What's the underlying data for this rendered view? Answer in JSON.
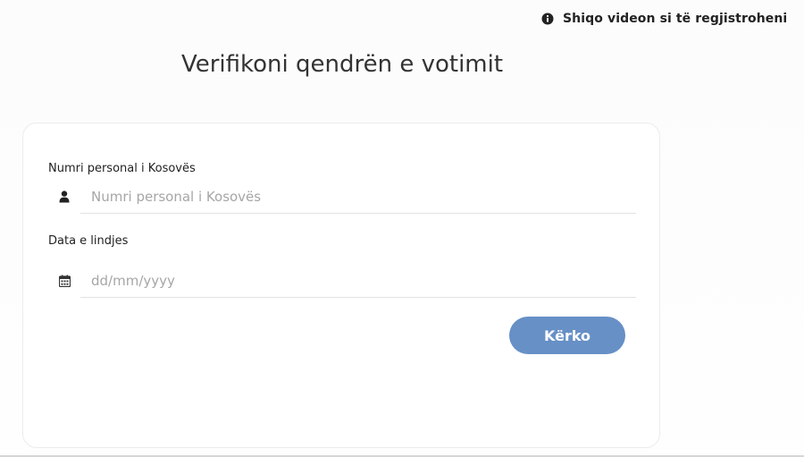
{
  "header": {
    "help_link_label": "Shiqo videon si të regjistroheni",
    "help_icon": "info-icon"
  },
  "title": "Verifikoni qendrën e votimit",
  "form": {
    "personal_number": {
      "label": "Numri personal i Kosovës",
      "placeholder": "Numri personal i Kosovës",
      "value": "",
      "icon": "user-icon"
    },
    "birth_date": {
      "label": "Data e lindjes",
      "placeholder": "dd/mm/yyyy",
      "value": "",
      "icon": "calendar-icon"
    },
    "submit_label": "Kërko"
  },
  "colors": {
    "accent": "#6690c6",
    "text": "#333333",
    "placeholder": "#a6a6a6"
  }
}
